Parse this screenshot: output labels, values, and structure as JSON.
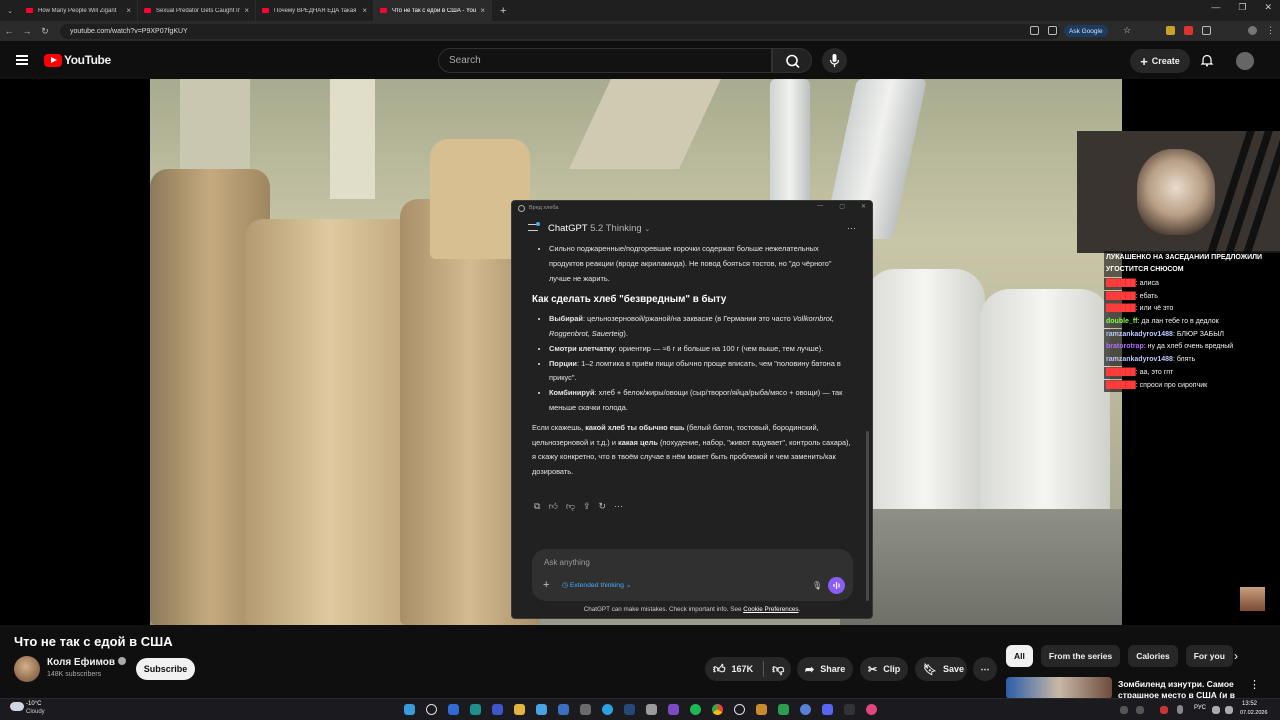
{
  "browser": {
    "tabs": [
      {
        "title": "How Many People Will Zigant",
        "active": false
      },
      {
        "title": "Sexual Predator Gets Caught In",
        "active": false
      },
      {
        "title": "Почему ВРЕДНАЯ ЕДА такая В",
        "active": false
      },
      {
        "title": "Что не так с едой в США - YouT",
        "active": true
      }
    ],
    "new_tab": "+",
    "url": "youtube.com/watch?v=P9XP07fgKUY",
    "ask_google": "Ask Google"
  },
  "youtube": {
    "logo_text": "YouTube",
    "search_placeholder": "Search",
    "create_label": "Create",
    "video_title": "Что не так с едой в США",
    "channel": {
      "name": "Коля Ефимов",
      "subscribers": "148K subscribers"
    },
    "subscribe_label": "Subscribe",
    "likes": "167K",
    "share_label": "Share",
    "clip_label": "Clip",
    "save_label": "Save",
    "chips": [
      "All",
      "From the series",
      "Calories",
      "For you"
    ],
    "active_chip": "All",
    "recommendation_title": "Зомбиленд изнутри. Самое страшное место в США (и в"
  },
  "overlay_chat": {
    "title": "ЛУКАШЕНКО НА ЗАСЕДАНИИ ПРЕДЛОЖИЛИ УГОСТИТСЯ СНЮСОМ",
    "messages": [
      {
        "user": "██████",
        "text": "алиса",
        "color": "#ff3b3b"
      },
      {
        "user": "██████",
        "text": "ебать",
        "color": "#ff3b3b"
      },
      {
        "user": "██████",
        "text": "или чё это",
        "color": "#ff3b3b"
      },
      {
        "user": "double_ff",
        "text": "да лан тебе го в дедлок",
        "color": "#7dff4a"
      },
      {
        "user": "ramzankadyrov1488",
        "text": "БЛЮР ЗАБЫЛ",
        "color": "#b9c9ff"
      },
      {
        "user": "bratorotrap",
        "text": "ну да хлеб очень вредный",
        "color": "#b36bff"
      },
      {
        "user": "ramzankadyrov1488",
        "text": "блять",
        "color": "#b9c9ff"
      },
      {
        "user": "██████",
        "text": "аа, это гпт",
        "color": "#ff3b3b"
      },
      {
        "user": "██████",
        "text": "спроси про сиропчик",
        "color": "#ff3b3b"
      }
    ]
  },
  "chatgpt": {
    "window_title": "Вред хлеба",
    "app_name": "ChatGPT",
    "model": "5.2 Thinking",
    "bullet_top": "Сильно поджаренные/подгоревшие корочки содержат больше нежелательных продуктов реакции (вроде акриламида). Не повод бояться тостов, но \"до чёрного\" лучше не жарить.",
    "heading": "Как сделать хлеб \"безвредным\" в быту",
    "bullets": [
      {
        "bold": "Выбирай",
        "text": ": цельнозерновой/ржаной/на закваске (в Германии это часто ",
        "italic": "Vollkornbrot, Roggenbrot, Sauerteig",
        "tail": ")."
      },
      {
        "bold": "Смотри клетчатку",
        "text": ": ориентир — ≈6 г и больше на 100 г (чем выше, тем лучше).",
        "italic": "",
        "tail": ""
      },
      {
        "bold": "Порции",
        "text": ": 1–2 ломтика в приём пищи обычно проще вписать, чем \"половину батона в прикус\".",
        "italic": "",
        "tail": ""
      },
      {
        "bold": "Комбинируй",
        "text": ": хлеб + белок/жиры/овощи (сыр/творог/яйца/рыба/мясо + овощи) — так меньше скачки голода.",
        "italic": "",
        "tail": ""
      }
    ],
    "para_a": "Если скажешь, ",
    "para_b": "какой хлеб ты обычно ешь",
    "para_c": " (белый батон, тостовый, бородинский, цельнозерновой и т.д.) и ",
    "para_d": "какая цель",
    "para_e": " (похудение, набор, \"живот вздувает\", контроль сахара), я скажу конкретно, что в твоём случае в нём может быть проблемой и чем заменить/как дозировать.",
    "input_placeholder": "Ask anything",
    "extended_thinking": "Extended thinking",
    "footer_text": "ChatGPT can make mistakes. Check important info. See ",
    "footer_link": "Cookie Preferences",
    "footer_end": "."
  },
  "taskbar": {
    "temperature": "-10°C",
    "condition": "Cloudy",
    "language": "РУС",
    "time": "13:52",
    "date": "07.02.2026"
  }
}
